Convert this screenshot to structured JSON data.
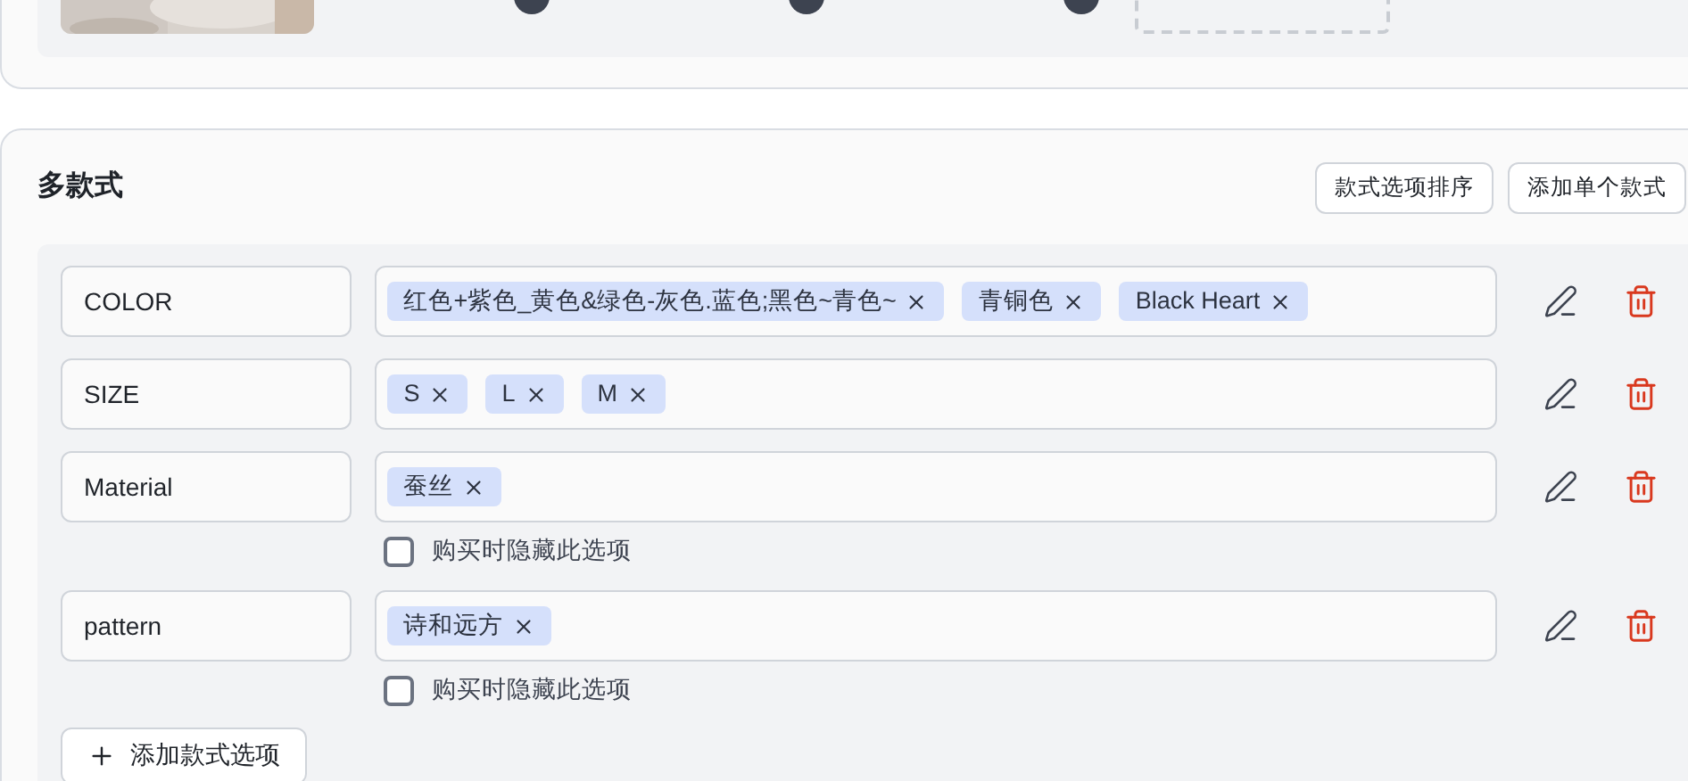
{
  "media_section": {
    "items": [
      {
        "kind": "picture"
      },
      {
        "kind": "handle"
      },
      {
        "kind": "handle"
      },
      {
        "kind": "handle"
      },
      {
        "kind": "upload_slot"
      }
    ]
  },
  "variants": {
    "title": "多款式",
    "actions": [
      {
        "label": "款式选项排序"
      },
      {
        "label": "添加单个款式"
      }
    ],
    "options": [
      {
        "name": "COLOR",
        "values": [
          "红色+紫色_黄色&绿色-灰色.蓝色;黑色~青色~",
          "青铜色",
          "Black Heart"
        ]
      },
      {
        "name": "SIZE",
        "values": [
          "S",
          "L",
          "M"
        ]
      },
      {
        "name": "Material",
        "values": [
          "蚕丝"
        ],
        "hide_option": {
          "label": "购买时隐藏此选项",
          "checked": false
        }
      },
      {
        "name": "pattern",
        "values": [
          "诗和远方"
        ],
        "hide_option": {
          "label": "购买时隐藏此选项",
          "checked": false
        }
      }
    ],
    "add_button": {
      "label": "添加款式选项"
    }
  }
}
